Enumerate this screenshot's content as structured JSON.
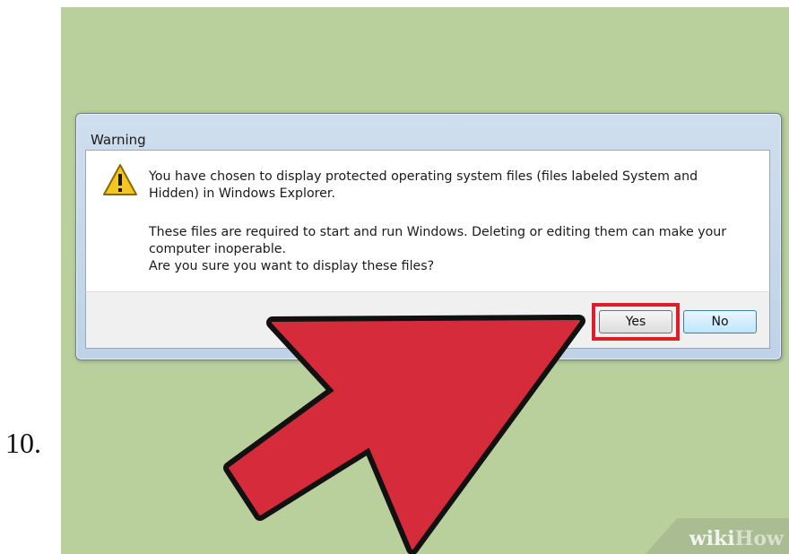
{
  "step": {
    "number": "10."
  },
  "dialog": {
    "title": "Warning",
    "icon": "warning-icon",
    "message_lines": [
      "You have chosen to display protected operating system files (files labeled System and",
      "Hidden) in Windows Explorer.",
      "These files are required to start and run Windows. Deleting or editing them can make your",
      "computer inoperable.",
      "Are you sure you want to display these files?"
    ],
    "buttons": {
      "yes": "Yes",
      "no": "No"
    }
  },
  "watermark": {
    "wiki": "wiki",
    "how": "How"
  },
  "colors": {
    "background": "#b9cf9c",
    "highlight": "#e01b2a",
    "arrow": "#d62b3b",
    "arrow_outline": "#111111"
  }
}
